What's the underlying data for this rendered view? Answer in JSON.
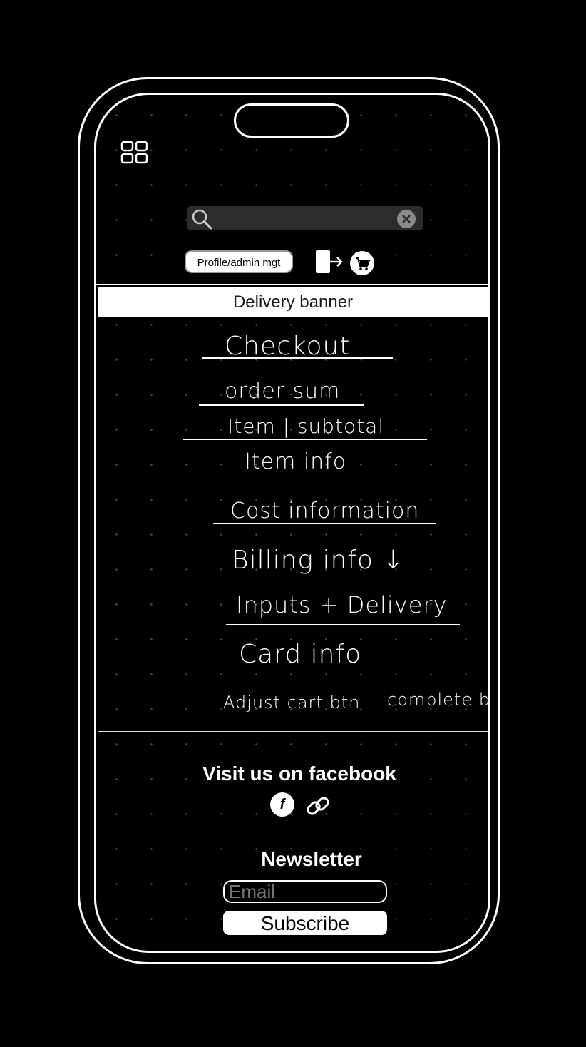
{
  "header": {
    "menu_icon": "grid-icon",
    "search": {
      "placeholder": "",
      "value": "",
      "search_icon": "search-icon",
      "clear_icon": "clear-icon"
    },
    "profile_button_label": "Profile/admin mgt",
    "logout_icon": "logout-icon",
    "cart_icon": "cart-icon"
  },
  "banner": {
    "label": "Delivery banner"
  },
  "sketch": {
    "checkout": "Checkout",
    "order_sum": "order sum",
    "item_subtotal": "Item | subtotal",
    "item_info": "Item info",
    "cost_information": "Cost information",
    "billing_info": "Billing info ↓",
    "inputs_delivery": "Inputs + Delivery",
    "card_info": "Card info",
    "adjust_cart_btn": "Adjust cart btn",
    "complete_btn": "complete btn"
  },
  "footer": {
    "facebook_title": "Visit us on facebook",
    "facebook_icon_glyph": "f",
    "link_icon": "link-icon",
    "newsletter_title": "Newsletter",
    "email_placeholder": "Email",
    "subscribe_label": "Subscribe"
  },
  "colors": {
    "background": "#000000",
    "foreground": "#ffffff",
    "search_bg": "#2c2c2c"
  }
}
